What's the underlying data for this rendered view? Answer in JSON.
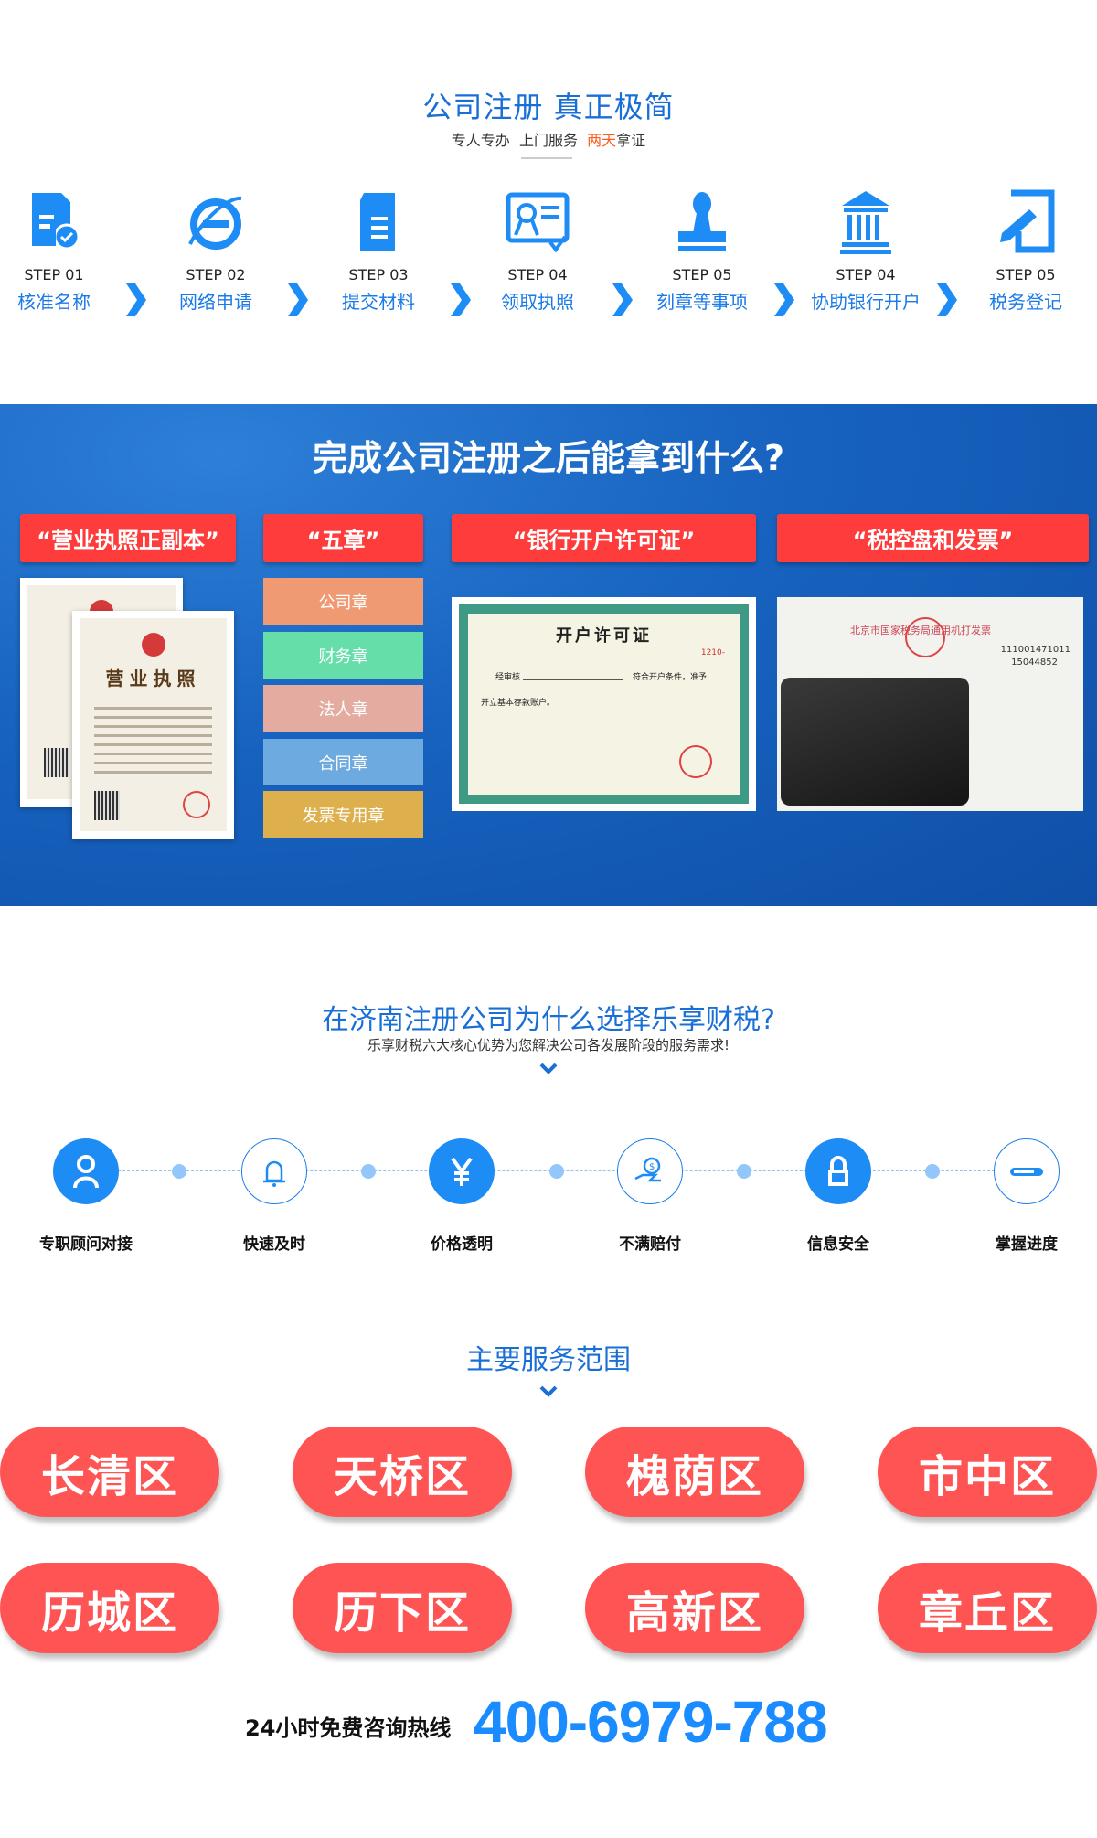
{
  "intro": {
    "title": "公司注册  真正极简",
    "subtitle_parts": [
      "专人专办  上门服务  ",
      "两天",
      "拿证"
    ]
  },
  "steps": [
    {
      "num": "STEP 01",
      "label": "核准名称",
      "icon": "document-check-icon"
    },
    {
      "num": "STEP 02",
      "label": "网络申请",
      "icon": "internet-explorer-icon"
    },
    {
      "num": "STEP 03",
      "label": "提交材料",
      "icon": "document-icon"
    },
    {
      "num": "STEP 04",
      "label": "领取执照",
      "icon": "certificate-icon"
    },
    {
      "num": "STEP 05",
      "label": "刻章等事项",
      "icon": "stamp-icon"
    },
    {
      "num": "STEP 04",
      "label": "协助银行开户",
      "icon": "bank-icon"
    },
    {
      "num": "STEP 05",
      "label": "税务登记",
      "icon": "edit-document-icon"
    }
  ],
  "deliverables": {
    "title": "完成公司注册之后能拿到什么?",
    "headers": [
      "“营业执照正副本”",
      "“五章”",
      "“银行开户许可证”",
      "“税控盘和发票”"
    ],
    "license_title": "营业执照",
    "seals": [
      {
        "label": "公司章",
        "color": "#f09a74"
      },
      {
        "label": "财务章",
        "color": "#66deaa"
      },
      {
        "label": "法人章",
        "color": "#e4aca0"
      },
      {
        "label": "合同章",
        "color": "#6caadf"
      },
      {
        "label": "发票专用章",
        "color": "#ddb04d"
      }
    ],
    "permit": {
      "title": "开户许可证",
      "line1": "经审核",
      "line2": "符合开户条件，准予",
      "line3": "开立基本存款账户。",
      "number": "1210-"
    },
    "invoice": {
      "title": "北京市国家税务局通用机打发票",
      "code": "111001471011",
      "no": "15044852"
    }
  },
  "why": {
    "title": "在济南注册公司为什么选择乐享财税?",
    "subtitle": "乐享财税六大核心优势为您解决公司各发展阶段的服务需求!",
    "items": [
      {
        "label": "专职顾问对接",
        "icon": "user-icon"
      },
      {
        "label": "快速及时",
        "icon": "bell-icon"
      },
      {
        "label": "价格透明",
        "icon": "yen-icon"
      },
      {
        "label": "不满赔付",
        "icon": "hand-coin-icon"
      },
      {
        "label": "信息安全",
        "icon": "lock-icon"
      },
      {
        "label": "掌握进度",
        "icon": "progress-icon"
      }
    ]
  },
  "services": {
    "title": "主要服务范围",
    "districts": [
      "长清区",
      "天桥区",
      "槐荫区",
      "市中区",
      "历城区",
      "历下区",
      "高新区",
      "章丘区"
    ]
  },
  "hotline": {
    "label": "24小时免费咨询热线",
    "number": "400-6979-788"
  },
  "colors": {
    "primary_blue": "#1a7ae8",
    "red": "#fe3c3c",
    "pill": "#fe5454",
    "hotline": "#1a8cff"
  }
}
